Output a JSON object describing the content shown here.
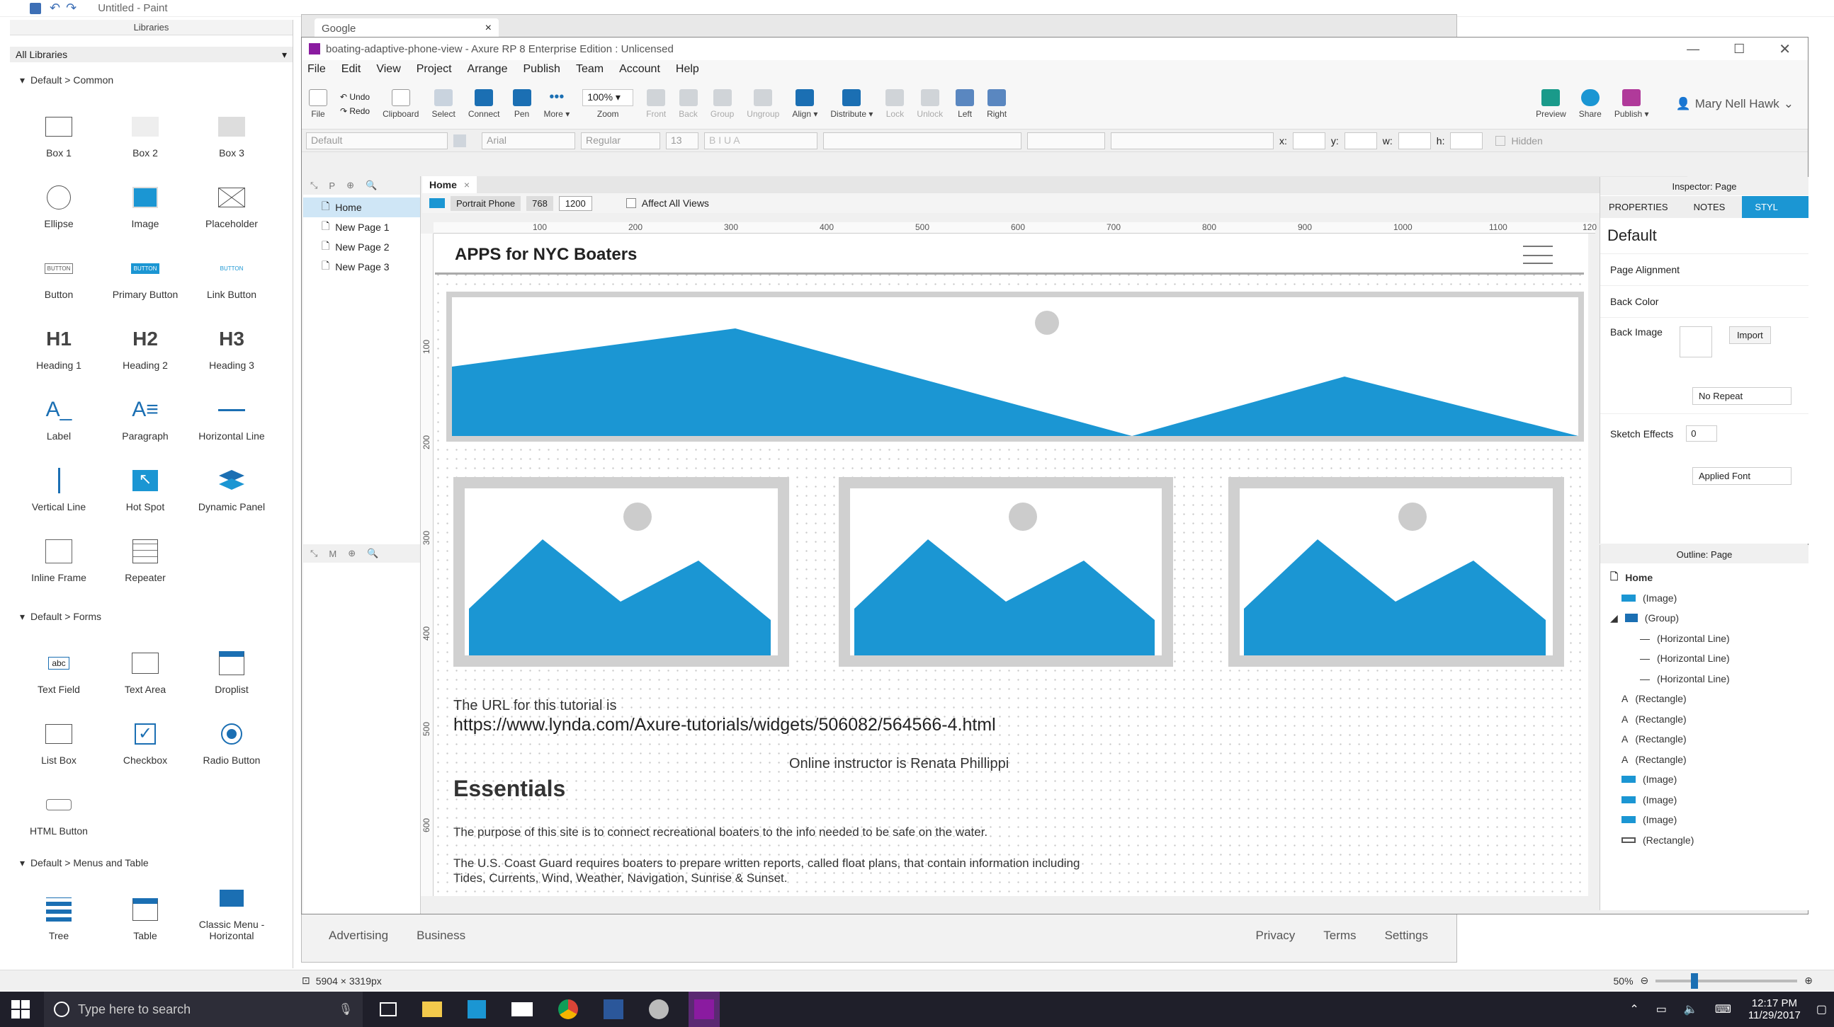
{
  "paint": {
    "title": "Untitled - Paint",
    "status_size": "5904 × 3319px",
    "zoom": "50%"
  },
  "libraries": {
    "title": "Libraries",
    "selector": "All Libraries",
    "sections": [
      {
        "title": "Default > Common",
        "items": [
          "Box 1",
          "Box 2",
          "Box 3",
          "Ellipse",
          "Image",
          "Placeholder",
          "Button",
          "Primary Button",
          "Link Button",
          "Heading 1",
          "Heading 2",
          "Heading 3",
          "Label",
          "Paragraph",
          "Horizontal Line",
          "Vertical Line",
          "Hot Spot",
          "Dynamic Panel",
          "Inline Frame",
          "Repeater"
        ]
      },
      {
        "title": "Default > Forms",
        "items": [
          "Text Field",
          "Text Area",
          "Droplist",
          "List Box",
          "Checkbox",
          "Radio Button",
          "HTML Button"
        ]
      },
      {
        "title": "Default > Menus and Table",
        "items": [
          "Tree",
          "Table",
          "Classic Menu - Horizontal"
        ]
      }
    ],
    "glyphs": {
      "h1": "H1",
      "h2": "H2",
      "h3": "H3",
      "button": "BUTTON",
      "textfield": "abc"
    }
  },
  "chrome": {
    "tab": "Google",
    "footer": [
      "Advertising",
      "Business",
      "Privacy",
      "Terms",
      "Settings"
    ]
  },
  "axure": {
    "title": "boating-adaptive-phone-view - Axure RP 8 Enterprise Edition : Unlicensed",
    "menu": [
      "File",
      "Edit",
      "View",
      "Project",
      "Arrange",
      "Publish",
      "Team",
      "Account",
      "Help"
    ],
    "toolbar": {
      "file": "File",
      "undo": "Undo",
      "redo": "Redo",
      "clipboard": "Clipboard",
      "select": "Select",
      "connect": "Connect",
      "pen": "Pen",
      "more": "More ▾",
      "zoom_value": "100%",
      "zoom": "Zoom",
      "front": "Front",
      "back": "Back",
      "group": "Group",
      "ungroup": "Ungroup",
      "align": "Align ▾",
      "distribute": "Distribute ▾",
      "lock": "Lock",
      "unlock": "Unlock",
      "left": "Left",
      "right": "Right",
      "preview": "Preview",
      "share": "Share",
      "publish": "Publish ▾",
      "user": "Mary Nell Hawk"
    },
    "format": {
      "style": "Default",
      "font": "Arial",
      "weight": "Regular",
      "size": "13",
      "x": "x:",
      "y": "y:",
      "w": "w:",
      "h": "h:",
      "hidden": "Hidden"
    },
    "pages": {
      "items": [
        "Home",
        "New Page 1",
        "New Page 2",
        "New Page 3"
      ]
    },
    "masters_label": "M",
    "tab": "Home",
    "views": {
      "name": "Portrait Phone",
      "a": "768",
      "b": "1200",
      "affect": "Affect All Views"
    },
    "ruler_x": [
      "100",
      "200",
      "300",
      "400",
      "500",
      "600",
      "700",
      "800",
      "900",
      "1000",
      "1100",
      "120"
    ],
    "ruler_y": [
      "100",
      "200",
      "300",
      "400",
      "500",
      "600"
    ],
    "canvas": {
      "header": "APPS for NYC Boaters",
      "url_label": "The URL for this tutorial is",
      "url": "https://www.lynda.com/Axure-tutorials/widgets/506082/564566-4.html",
      "instructor": "Online instructor is Renata Phillippi",
      "essentials": "Essentials",
      "p1": "The purpose of this site is to connect recreational boaters to the info needed to be safe on the water.",
      "p2a": "The U.S. Coast Guard requires boaters to prepare written reports, called float plans, that contain information including",
      "p2b": "Tides, Currents, Wind, Weather, Navigation, Sunrise & Sunset."
    },
    "inspector": {
      "title": "Inspector: Page",
      "tabs": [
        "PROPERTIES",
        "NOTES",
        "STYL"
      ],
      "style_name": "Default",
      "page_alignment": "Page Alignment",
      "back_color": "Back Color",
      "back_image": "Back Image",
      "import": "Import",
      "repeat": "No Repeat",
      "sketch": "Sketch Effects",
      "sketch_value": "0",
      "applied_font": "Applied Font"
    },
    "outline": {
      "title": "Outline: Page",
      "items": [
        "Home",
        "(Image)",
        "(Group)",
        "(Horizontal Line)",
        "(Horizontal Line)",
        "(Horizontal Line)",
        "(Rectangle)",
        "(Rectangle)",
        "(Rectangle)",
        "(Rectangle)",
        "(Image)",
        "(Image)",
        "(Image)",
        "(Rectangle)"
      ]
    }
  },
  "taskbar": {
    "search": "Type here to search",
    "time": "12:17 PM",
    "date": "11/29/2017"
  },
  "colors": {
    "accent": "#1b96d3",
    "paint_bg": "#f0f0f0"
  }
}
